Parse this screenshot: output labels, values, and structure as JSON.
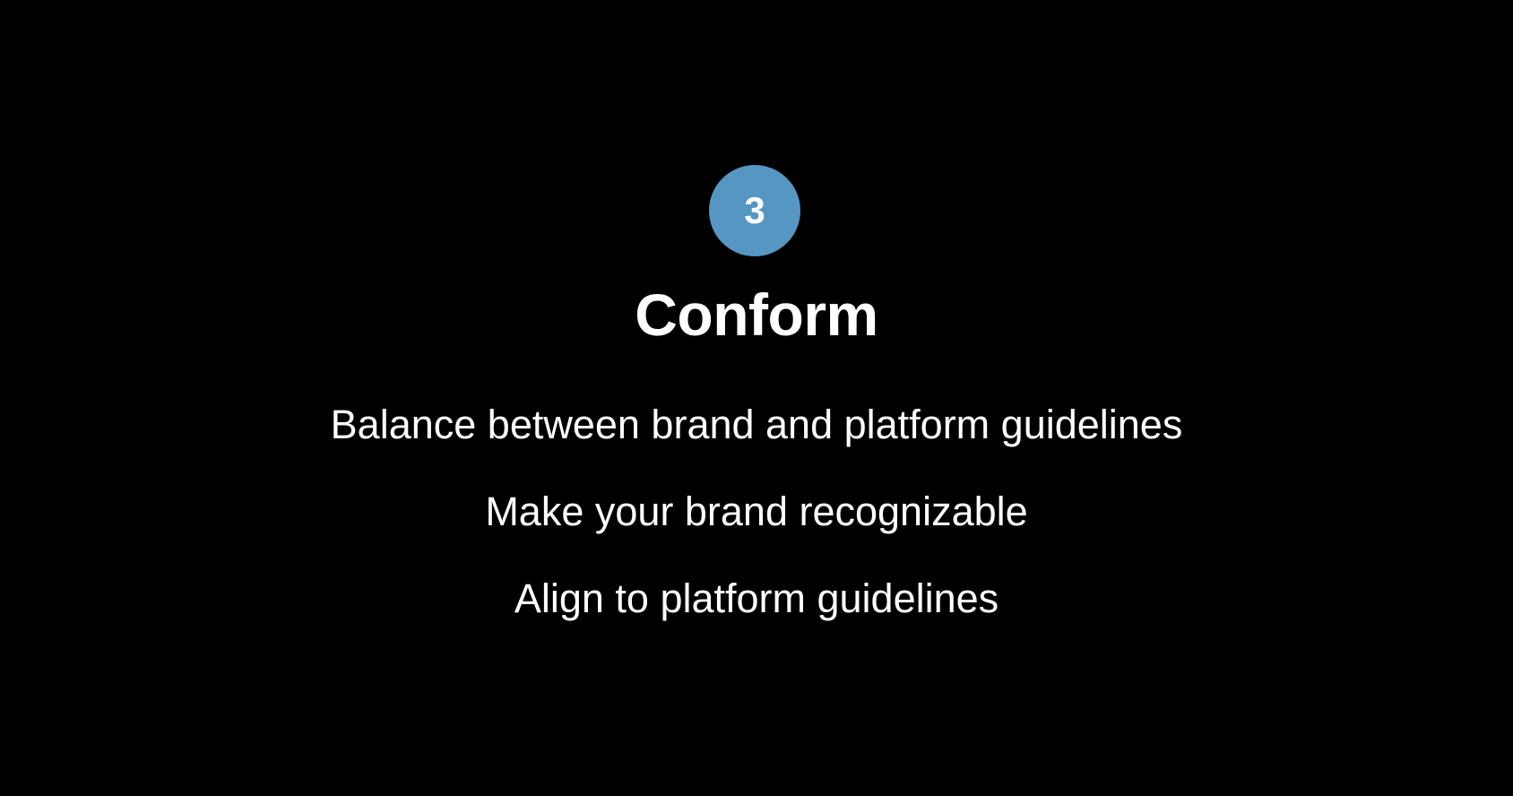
{
  "slide": {
    "step_number": "3",
    "title": "Conform",
    "points": [
      "Balance between brand and platform guidelines",
      "Make your brand recognizable",
      "Align to platform guidelines"
    ]
  },
  "colors": {
    "background": "#000000",
    "badge": "#5596c3",
    "text": "#ffffff"
  }
}
